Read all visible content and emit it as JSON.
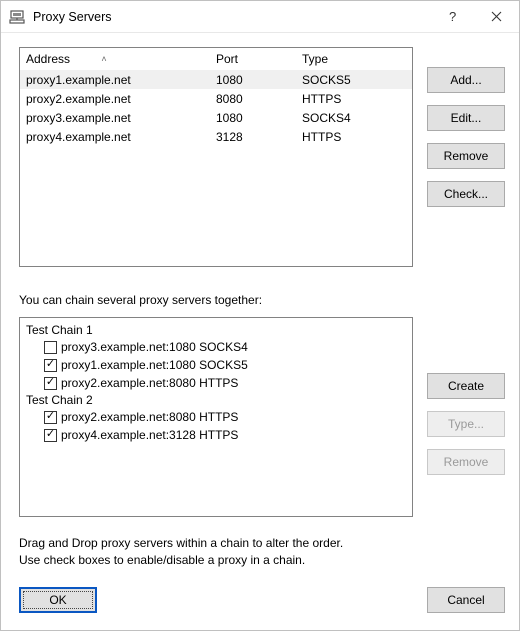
{
  "window": {
    "title": "Proxy Servers"
  },
  "table": {
    "headers": {
      "address": "Address",
      "port": "Port",
      "type": "Type"
    },
    "rows": [
      {
        "address": "proxy1.example.net",
        "port": "1080",
        "type": "SOCKS5",
        "selected": true
      },
      {
        "address": "proxy2.example.net",
        "port": "8080",
        "type": "HTTPS",
        "selected": false
      },
      {
        "address": "proxy3.example.net",
        "port": "1080",
        "type": "SOCKS4",
        "selected": false
      },
      {
        "address": "proxy4.example.net",
        "port": "3128",
        "type": "HTTPS",
        "selected": false
      }
    ]
  },
  "buttons": {
    "add": "Add...",
    "edit": "Edit...",
    "remove": "Remove",
    "check": "Check...",
    "create": "Create",
    "type": "Type...",
    "remove_chain": "Remove",
    "ok": "OK",
    "cancel": "Cancel"
  },
  "chain_label": "You can chain several proxy servers together:",
  "chains": [
    {
      "name": "Test Chain 1",
      "items": [
        {
          "label": "proxy3.example.net:1080 SOCKS4",
          "checked": false
        },
        {
          "label": "proxy1.example.net:1080 SOCKS5",
          "checked": true
        },
        {
          "label": "proxy2.example.net:8080 HTTPS",
          "checked": true
        }
      ]
    },
    {
      "name": "Test Chain 2",
      "items": [
        {
          "label": "proxy2.example.net:8080 HTTPS",
          "checked": true
        },
        {
          "label": "proxy4.example.net:3128 HTTPS",
          "checked": true
        }
      ]
    }
  ],
  "hint_line1": "Drag and Drop proxy servers within a chain to alter the order.",
  "hint_line2": "Use check boxes to enable/disable a proxy in a chain."
}
